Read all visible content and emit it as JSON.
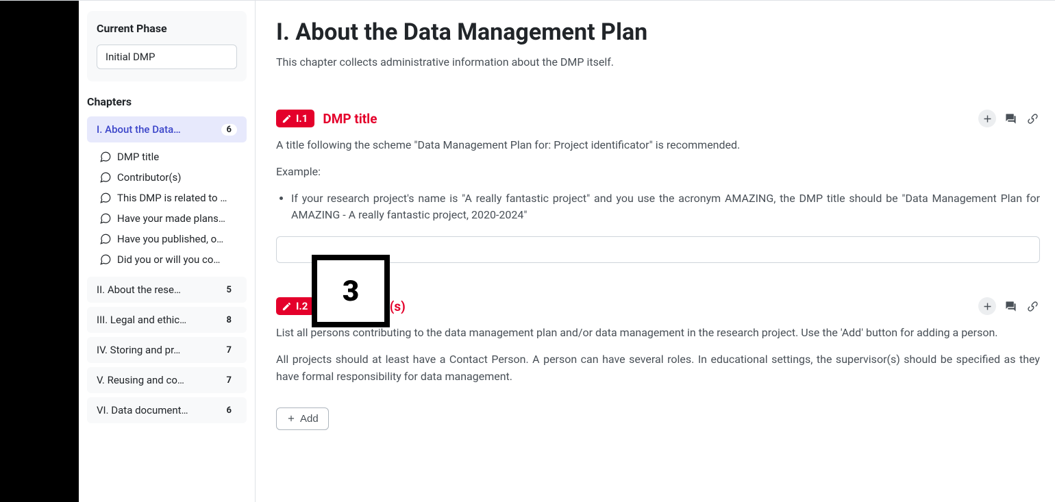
{
  "sidebar": {
    "phase_label": "Current Phase",
    "phase_value": "Initial DMP",
    "chapters_label": "Chapters",
    "chapters": [
      {
        "label": "I.  About the Data…",
        "badge": "6",
        "active": true
      },
      {
        "label": "II.  About the rese…",
        "badge": "5",
        "active": false
      },
      {
        "label": "III.  Legal and ethic…",
        "badge": "8",
        "active": false
      },
      {
        "label": "IV.  Storing and pr…",
        "badge": "7",
        "active": false
      },
      {
        "label": "V.  Reusing and co…",
        "badge": "7",
        "active": false
      },
      {
        "label": "VI.  Data document…",
        "badge": "6",
        "active": false
      }
    ],
    "questions": [
      {
        "label": "DMP title"
      },
      {
        "label": "Contributor(s)"
      },
      {
        "label": "This DMP is related to …"
      },
      {
        "label": "Have your made plans…"
      },
      {
        "label": "Have you published, o…"
      },
      {
        "label": "Did you or will you co…"
      }
    ]
  },
  "main": {
    "title": "I. About the Data Management Plan",
    "description": "This chapter collects administrative information about the DMP itself.",
    "q1": {
      "badge": "I.1",
      "title": "DMP title",
      "p1": "A title following the scheme \"Data Management Plan for: Project identificator\" is recommended.",
      "p2": "Example:",
      "li1": "If your research project's name is \"A really fantastic project\" and you use the acronym AMAZING, the DMP title should be \"Data Management Plan for AMAZING - A really fantastic project, 2020-2024\"",
      "input_value": ""
    },
    "q2": {
      "badge": "I.2",
      "title": "Contributor(s)",
      "p1": "List all persons contributing to the data management plan and/or data management in the research project. Use the 'Add' button for adding a person.",
      "p2": "All projects should at least have a Contact Person. A person can have several roles. In educational settings, the supervisor(s) should be specified as they have formal responsibility for data management.",
      "add_label": "Add"
    }
  },
  "annotation": {
    "number": "3"
  }
}
